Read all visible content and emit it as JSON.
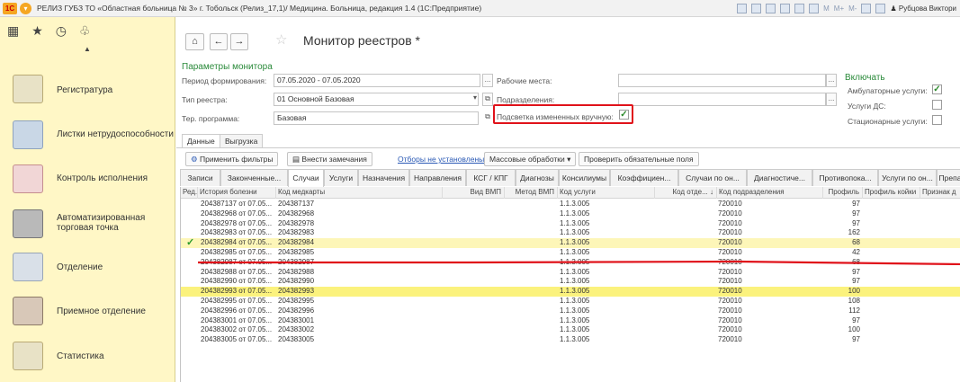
{
  "titlebar": {
    "title": "РЕЛИЗ ГУБЗ ТО «Областная больница № 3» г. Тобольск (Релиз_17,1)/ Медицина. Больница, редакция 1.4  (1С:Предприятие)",
    "tools": [
      "M",
      "M+",
      "M-"
    ],
    "user": "Рубцова Виктори"
  },
  "sidebar": {
    "items": [
      {
        "label": "Регистратура",
        "icon": "registry-icon"
      },
      {
        "label": "Листки нетрудоспособности",
        "icon": "sick-leave-icon"
      },
      {
        "label": "Контроль исполнения",
        "icon": "control-icon"
      },
      {
        "label": "Автоматизированная торговая точка",
        "icon": "cash-register-icon"
      },
      {
        "label": "Отделение",
        "icon": "ward-icon"
      },
      {
        "label": "Приемное отделение",
        "icon": "reception-icon"
      },
      {
        "label": "Статистика",
        "icon": "statistics-icon"
      }
    ]
  },
  "page": {
    "title": "Монитор реестров *"
  },
  "params": {
    "group_title": "Параметры монитора",
    "period_label": "Период формирования:",
    "period_value": "07.05.2020 - 07.05.2020",
    "type_label": "Тип реестра:",
    "type_value": "01 Основной Базовая",
    "program_label": "Тер. программа:",
    "program_value": "Базовая",
    "workplaces_label": "Рабочие места:",
    "workplaces_value": "",
    "departments_label": "Подразделения:",
    "departments_value": "",
    "highlight_label": "Подсветка измененных вручную:",
    "highlight_checked": true
  },
  "include": {
    "title": "Включать",
    "items": [
      {
        "label": "Амбулаторные услуги:",
        "checked": true
      },
      {
        "label": "Услуги ДС:",
        "checked": false
      },
      {
        "label": "Стационарные услуги:",
        "checked": false
      }
    ]
  },
  "tabs": [
    "Данные",
    "Выгрузка"
  ],
  "toolbar": {
    "apply_filters": "Применить фильтры",
    "add_remarks": "Внести замечания",
    "filters_link": "Отборы не установлены",
    "mass_processing": "Массовые обработки",
    "check_fields": "Проверить обязательные поля"
  },
  "subtabs": [
    "Записи",
    "Законченные...",
    "Случаи",
    "Услуги",
    "Назначения",
    "Направления",
    "КСГ / КПГ",
    "Диагнозы",
    "Консилиумы",
    "Коэффициен...",
    "Случаи по он...",
    "Диагностиче...",
    "Противопока...",
    "Услуги по он...",
    "Препа"
  ],
  "grid": {
    "headers": [
      "Ред.",
      "История болезни",
      "Код медкарты",
      "Вид ВМП",
      "Метод ВМП",
      "Код услуги",
      "Код отде...",
      "Код подразделения",
      "Профиль",
      "Профиль койки",
      "Признак д"
    ],
    "rows": [
      {
        "history": "204387137 от 07.05...",
        "card": "204387137",
        "service": "1.1.3.005",
        "dept": "720010",
        "profile": "97",
        "style": "",
        "check": false
      },
      {
        "history": "204382968 от 07.05...",
        "card": "204382968",
        "service": "1.1.3.005",
        "dept": "720010",
        "profile": "97",
        "style": "",
        "check": false
      },
      {
        "history": "204382978 от 07.05...",
        "card": "204382978",
        "service": "1.1.3.005",
        "dept": "720010",
        "profile": "97",
        "style": "",
        "check": false
      },
      {
        "history": "204382983 от 07.05...",
        "card": "204382983",
        "service": "1.1.3.005",
        "dept": "720010",
        "profile": "162",
        "style": "",
        "check": false
      },
      {
        "history": "204382984 от 07.05...",
        "card": "204382984",
        "service": "1.1.3.005",
        "dept": "720010",
        "profile": "68",
        "style": "hl",
        "check": true
      },
      {
        "history": "204382985 от 07.05...",
        "card": "204382985",
        "service": "1.1.3.005",
        "dept": "720010",
        "profile": "42",
        "style": "",
        "check": false
      },
      {
        "history": "204382987 от 07.05...",
        "card": "204382987",
        "service": "1.1.3.005",
        "dept": "720010",
        "profile": "68",
        "style": "",
        "check": false
      },
      {
        "history": "204382988 от 07.05...",
        "card": "204382988",
        "service": "1.1.3.005",
        "dept": "720010",
        "profile": "97",
        "style": "",
        "check": false
      },
      {
        "history": "204382990 от 07.05...",
        "card": "204382990",
        "service": "1.1.3.005",
        "dept": "720010",
        "profile": "97",
        "style": "",
        "check": false
      },
      {
        "history": "204382993 от 07.05...",
        "card": "204382993",
        "service": "1.1.3.005",
        "dept": "720010",
        "profile": "100",
        "style": "sel",
        "check": false
      },
      {
        "history": "204382995 от 07.05...",
        "card": "204382995",
        "service": "1.1.3.005",
        "dept": "720010",
        "profile": "108",
        "style": "",
        "check": false
      },
      {
        "history": "204382996 от 07.05...",
        "card": "204382996",
        "service": "1.1.3.005",
        "dept": "720010",
        "profile": "112",
        "style": "",
        "check": false
      },
      {
        "history": "204383001 от 07.05...",
        "card": "204383001",
        "service": "1.1.3.005",
        "dept": "720010",
        "profile": "97",
        "style": "",
        "check": false
      },
      {
        "history": "204383002 от 07.05...",
        "card": "204383002",
        "service": "1.1.3.005",
        "dept": "720010",
        "profile": "100",
        "style": "",
        "check": false
      },
      {
        "history": "204383005 от 07.05...",
        "card": "204383005",
        "service": "1.1.3.005",
        "dept": "720010",
        "profile": "97",
        "style": "",
        "check": false
      }
    ]
  },
  "colors": {
    "sidebar_bg": "#fff7c6",
    "highlight_row": "#fdf6b8",
    "selected_row": "#fbf27d",
    "annotation_red": "#e0121a",
    "group_title_green": "#2a8a3a"
  }
}
